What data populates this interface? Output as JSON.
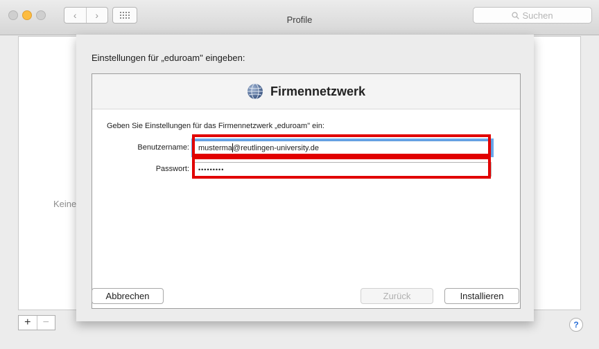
{
  "window": {
    "title": "Profile",
    "search_placeholder": "Suchen"
  },
  "nav": {
    "back_glyph": "‹",
    "forward_glyph": "›"
  },
  "background": {
    "empty_text": "Keine P",
    "add_glyph": "+",
    "remove_glyph": "−",
    "help_glyph": "?"
  },
  "sheet": {
    "heading": "Einstellungen für „eduroam\" eingeben:",
    "header_title": "Firmennetzwerk",
    "description": "Geben Sie Einstellungen für das Firmennetzwerk „eduroam\" ein:",
    "username_label": "Benutzername:",
    "username_value_before_cursor": "musterma",
    "username_value_after_cursor": "@reutlingen-university.de",
    "password_label": "Passwort:",
    "password_value": "•••••••••",
    "cancel_label": "Abbrechen",
    "back_label": "Zurück",
    "install_label": "Installieren"
  },
  "colors": {
    "highlight": "#e10000",
    "focus_ring": "#6aa7ea",
    "traffic_yellow": "#fdbc40"
  },
  "icons": [
    "close-icon",
    "minimize-icon",
    "maximize-icon",
    "back-arrow-icon",
    "forward-arrow-icon",
    "grid-icon",
    "search-icon",
    "globe-icon",
    "help-icon"
  ]
}
